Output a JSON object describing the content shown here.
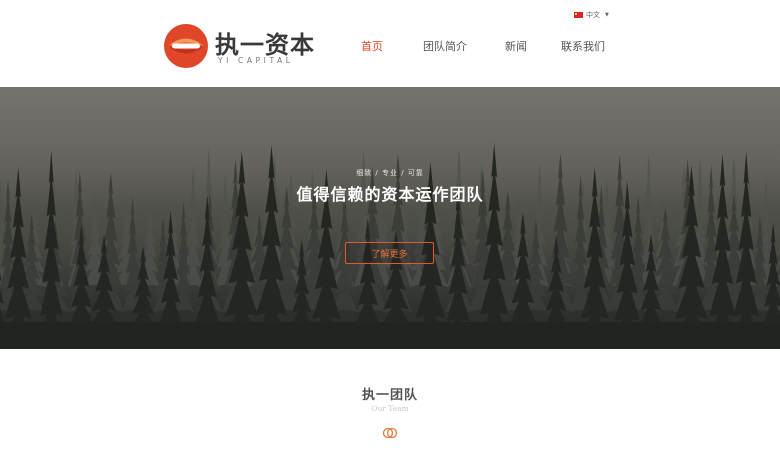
{
  "header": {
    "logo": {
      "cn": "执一资本",
      "en": "YI CAPITAL"
    },
    "language": {
      "label": "中文",
      "flag_icon": "china-flag-icon",
      "caret_icon": "caret-down-icon"
    },
    "nav": [
      {
        "label": "首页",
        "active": true
      },
      {
        "label": "团队简介",
        "active": false
      },
      {
        "label": "新闻",
        "active": false
      },
      {
        "label": "联系我们",
        "active": false
      }
    ]
  },
  "hero": {
    "tagline": "细致 / 专业 / 可靠",
    "title": "值得信赖的资本运作团队",
    "button_label": "了解更多"
  },
  "team": {
    "title": "执一团队",
    "subtitle": "Our Team",
    "icon": "linked-rings-icon"
  },
  "colors": {
    "accent": "#e0472a",
    "button_border": "#e05a2c",
    "text_dark": "#555555"
  }
}
